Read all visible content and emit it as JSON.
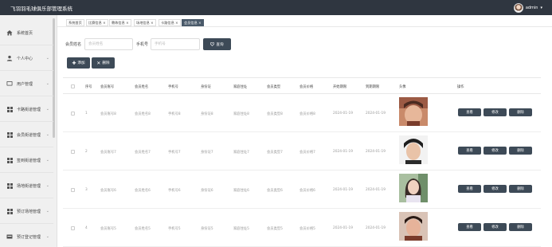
{
  "app": {
    "title": "飞羽羽毛球俱乐部管理系统"
  },
  "user": {
    "name": "admin"
  },
  "sidebar": {
    "items": [
      {
        "label": "系统首页",
        "icon": "home-icon",
        "has_chevron": false
      },
      {
        "label": "个人中心",
        "icon": "user-icon",
        "has_chevron": true
      },
      {
        "label": "用户管理",
        "icon": "users-icon",
        "has_chevron": true
      },
      {
        "label": "卡路街道管理",
        "icon": "grid-icon",
        "has_chevron": true
      },
      {
        "label": "会员街道管理",
        "icon": "grid-icon",
        "has_chevron": true
      },
      {
        "label": "签到街道管理",
        "icon": "grid-icon",
        "has_chevron": true
      },
      {
        "label": "场地街道管理",
        "icon": "grid-icon",
        "has_chevron": true
      },
      {
        "label": "预订场地管理",
        "icon": "grid-icon",
        "has_chevron": true
      },
      {
        "label": "预订登记管理",
        "icon": "grid-icon",
        "has_chevron": true
      }
    ]
  },
  "tabs": [
    {
      "label": "系统首页",
      "active": false,
      "closable": false
    },
    {
      "label": "比赛信息 ×",
      "active": false
    },
    {
      "label": "教练信息 ×",
      "active": false
    },
    {
      "label": "场地信息 ×",
      "active": false
    },
    {
      "label": "卡路信息 ×",
      "active": false
    },
    {
      "label": "会员信息 ×",
      "active": true
    }
  ],
  "search": {
    "name_label": "会员姓名",
    "name_placeholder": "会员姓名",
    "phone_label": "手机号",
    "phone_placeholder": "手机号",
    "query_button": "查询"
  },
  "actions": {
    "add_label": "添加",
    "delete_label": "删除"
  },
  "table": {
    "columns": [
      "序号",
      "会员账号",
      "会员姓名",
      "手机号",
      "身份证",
      "家庭住址",
      "会员类型",
      "会员价格",
      "开始期限",
      "到期期限",
      "头像",
      "操作"
    ],
    "rows": [
      {
        "index": "1",
        "account": "会员账号8",
        "name": "会员姓名8",
        "phone": "手机号8",
        "id_card": "身份证8",
        "address": "家庭住址8",
        "type": "会员类型8",
        "price": "会员价格8",
        "start": "2024-01-19",
        "end": "2024-01-19",
        "photo_tone": "#8a4a3a"
      },
      {
        "index": "2",
        "account": "会员账号7",
        "name": "会员姓名7",
        "phone": "手机号7",
        "id_card": "身份证7",
        "address": "家庭住址7",
        "type": "会员类型7",
        "price": "会员价格7",
        "start": "2024-01-19",
        "end": "2024-01-19",
        "photo_tone": "#2b2b2b"
      },
      {
        "index": "3",
        "account": "会员账号6",
        "name": "会员姓名6",
        "phone": "手机号6",
        "id_card": "身份证6",
        "address": "家庭住址6",
        "type": "会员类型6",
        "price": "会员价格6",
        "start": "2024-01-19",
        "end": "2024-01-19",
        "photo_tone": "#6f8f6a"
      },
      {
        "index": "4",
        "account": "会员账号5",
        "name": "会员姓名5",
        "phone": "手机号5",
        "id_card": "身份证5",
        "address": "家庭住址5",
        "type": "会员类型5",
        "price": "会员价格5",
        "start": "2024-01-19",
        "end": "2024-01-19",
        "photo_tone": "#7a3b2b"
      }
    ],
    "row_actions": {
      "view": "查看",
      "edit": "修改",
      "delete": "删除"
    }
  },
  "colors": {
    "topbar": "#2f3640",
    "button": "#3d4a57",
    "active_tab": "#4a5a6a",
    "sidebar": "#f0f0f0"
  }
}
